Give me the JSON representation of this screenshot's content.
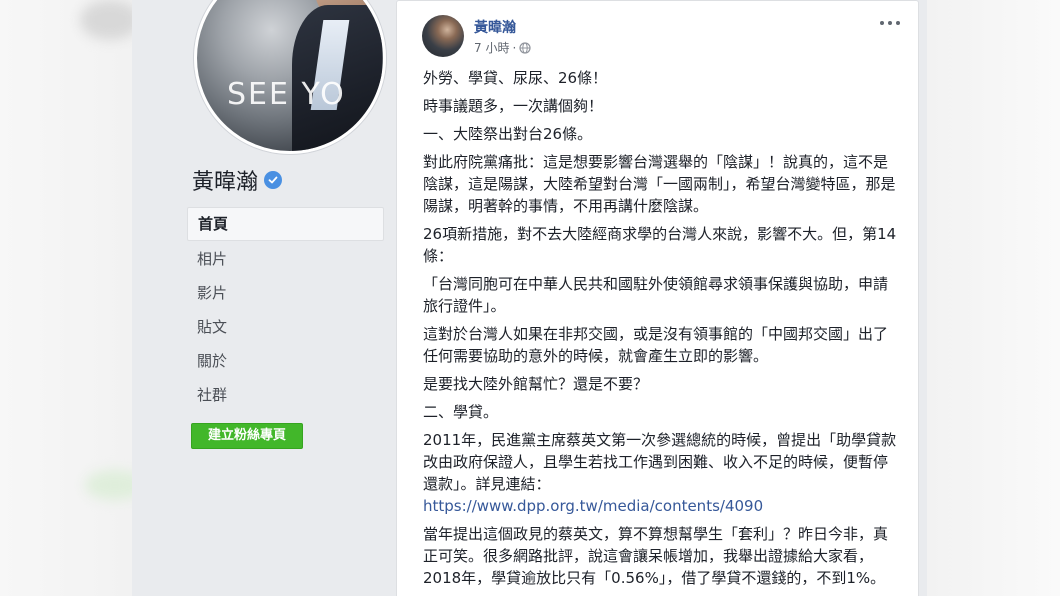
{
  "page": {
    "name": "黃暐瀚",
    "profile_caption": "SEE YO"
  },
  "nav": {
    "items": [
      "首頁",
      "相片",
      "影片",
      "貼文",
      "關於",
      "社群"
    ],
    "active_index": 0
  },
  "create_page_button": "建立粉絲專頁",
  "post": {
    "author": "黃暐瀚",
    "time": "7 小時",
    "separator": "·",
    "privacy_icon": "globe-icon",
    "paragraphs": [
      "外勞、學貸、尿尿、26條！",
      "時事議題多，一次講個夠！",
      "一、大陸祭出對台26條。",
      "對此府院黨痛批：這是想要影響台灣選舉的「陰謀」！說真的，這不是陰謀，這是陽謀，大陸希望對台灣「一國兩制」，希望台灣變特區，那是陽謀，明著幹的事情，不用再講什麼陰謀。",
      "26項新措施，對不去大陸經商求學的台灣人來說，影響不大。但，第14條：",
      "「台灣同胞可在中華人民共和國駐外使領館尋求領事保護與協助，申請旅行證件」。",
      "這對於台灣人如果在非邦交國，或是沒有領事館的「中國邦交國」出了任何需要協助的意外的時候，就會產生立即的影響。",
      "是要找大陸外館幫忙？還是不要？",
      "二、學貸。",
      "2011年，民進黨主席蔡英文第一次參選總統的時候，曾提出「助學貸款改由政府保證人，且學生若找工作遇到困難、收入不足的時候，便暫停還款」。詳見連結："
    ],
    "link": "https://www.dpp.org.tw/media/contents/4090",
    "paragraphs_after": [
      "當年提出這個政見的蔡英文，算不算想幫學生「套利」？昨日今非，真正可笑。很多網路批評，說這會讓呆帳增加，我舉出證據給大家看，2018年，學貸逾放比只有「0.56%」，借了學貸不還錢的，不到1%。"
    ]
  },
  "colors": {
    "page_background": "#e9ebee",
    "link_blue": "#365899",
    "green_button": "#42b72a",
    "verified_blue": "#4a90e2",
    "text": "#1d2129",
    "meta_gray": "#616770"
  }
}
